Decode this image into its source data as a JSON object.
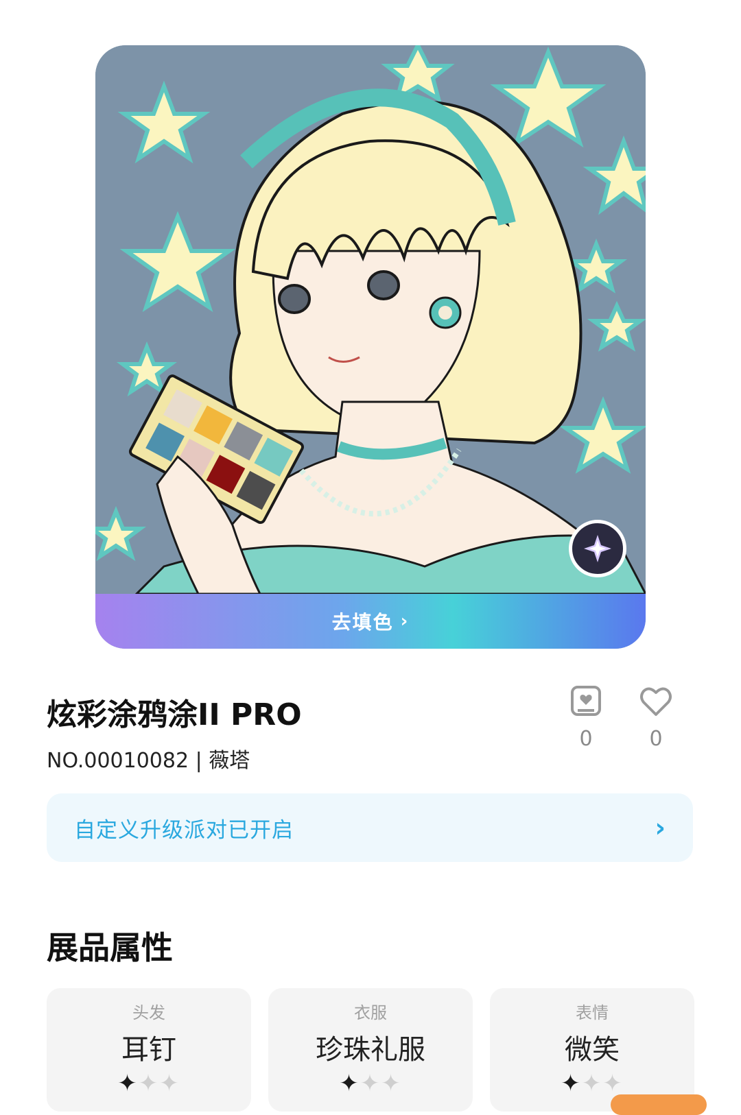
{
  "colors": {
    "accent": "#2aa8df",
    "banner_bg": "#eef8fd",
    "card_bg": "#f4f4f4",
    "gradient": [
      "#a582ee",
      "#6ca6ec",
      "#47d1d8",
      "#5a78ee"
    ]
  },
  "artwork": {
    "fill_button_label": "去填色",
    "fill_button_icon": "chevron-right-icon",
    "badge_icon": "sparkle-star-icon"
  },
  "item": {
    "title": "炫彩涂鸦涂II PRO",
    "serial": "NO.00010082 | 薇塔"
  },
  "stats": {
    "collect": {
      "icon": "collection-icon",
      "count": "0"
    },
    "likes": {
      "icon": "heart-icon",
      "count": "0"
    }
  },
  "banner": {
    "text": "自定义升级派对已开启",
    "icon": "chevron-right-icon"
  },
  "section": {
    "title": "展品属性"
  },
  "attributes": [
    {
      "label": "头发",
      "value": "耳钉",
      "rating": 1,
      "max": 3
    },
    {
      "label": "衣服",
      "value": "珍珠礼服",
      "rating": 1,
      "max": 3
    },
    {
      "label": "表情",
      "value": "微笑",
      "rating": 1,
      "max": 3
    }
  ]
}
